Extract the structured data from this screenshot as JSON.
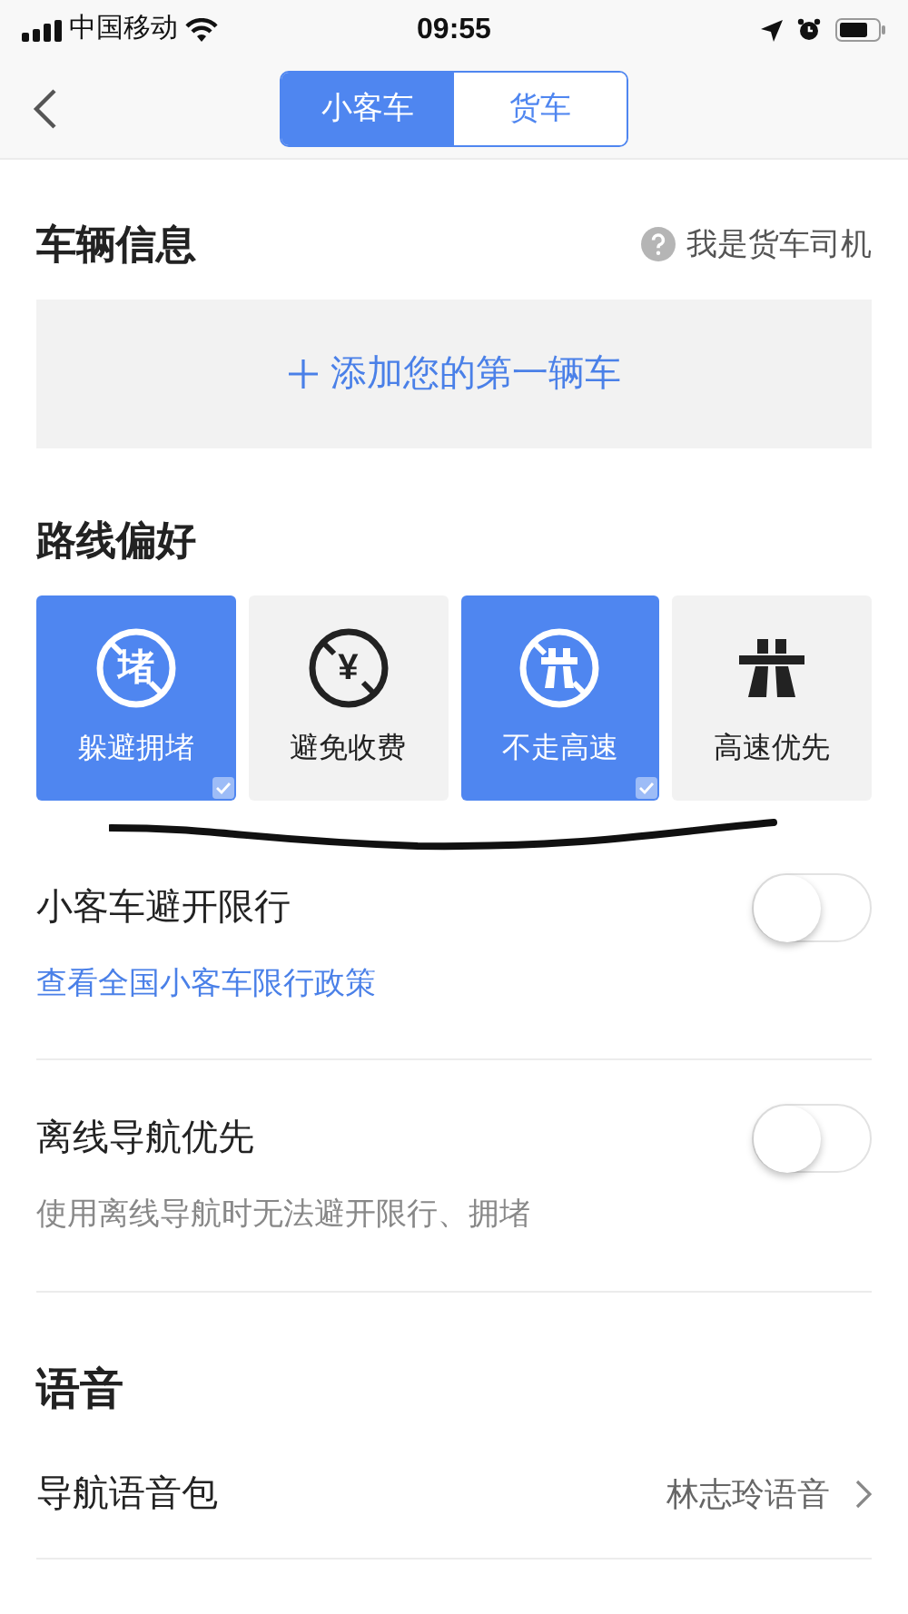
{
  "status_bar": {
    "carrier": "中国移动",
    "time": "09:55"
  },
  "vehicle_tabs": [
    {
      "label": "小客车",
      "selected": true
    },
    {
      "label": "货车",
      "selected": false
    }
  ],
  "vehicle_info": {
    "title": "车辆信息",
    "help_link": "我是货车司机",
    "add_button": "添加您的第一辆车"
  },
  "route_preferences": {
    "title": "路线偏好",
    "options": [
      {
        "label": "躲避拥堵",
        "kind": "congestion",
        "icon_text": "堵",
        "selected": true
      },
      {
        "label": "避免收费",
        "kind": "toll",
        "icon_text": "¥",
        "selected": false
      },
      {
        "label": "不走高速",
        "kind": "no_highway",
        "selected": true
      },
      {
        "label": "高速优先",
        "kind": "highway",
        "selected": false
      }
    ]
  },
  "settings": [
    {
      "title": "小客车避开限行",
      "on": false,
      "link": "查看全国小客车限行政策"
    },
    {
      "title": "离线导航优先",
      "on": false,
      "note": "使用离线导航时无法避开限行、拥堵"
    }
  ],
  "voice": {
    "title": "语音",
    "rows": [
      {
        "label": "导航语音包",
        "value": "林志玲语音"
      }
    ]
  }
}
